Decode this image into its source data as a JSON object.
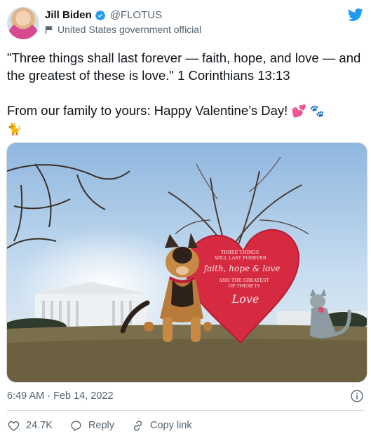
{
  "author": {
    "name": "Jill Biden",
    "handle": "@FLOTUS",
    "affiliation": "United States government official"
  },
  "tweet": {
    "text_line1": "\"Three things shall last forever — faith, hope, and love — and the greatest of these is love.\" 1 Corinthians 13:13",
    "text_line2": "From our family to yours: Happy Valentine’s Day!",
    "emoji_heart": "💕",
    "emoji_paws": "🐾",
    "emoji_cat": "🐈",
    "timestamp": "6:49 AM · Feb 14, 2022"
  },
  "image": {
    "heart_sign_text": [
      "THREE THINGS",
      "WILL LAST FOREVER",
      "faith, hope & love",
      "AND THE GREATEST",
      "OF THESE IS",
      "Love"
    ]
  },
  "actions": {
    "likes": "24.7K",
    "reply_label": "Reply",
    "copy_link_label": "Copy link"
  },
  "colors": {
    "brand_blue": "#1d9bf0",
    "text_secondary": "#536471",
    "like_red": "#536471"
  }
}
